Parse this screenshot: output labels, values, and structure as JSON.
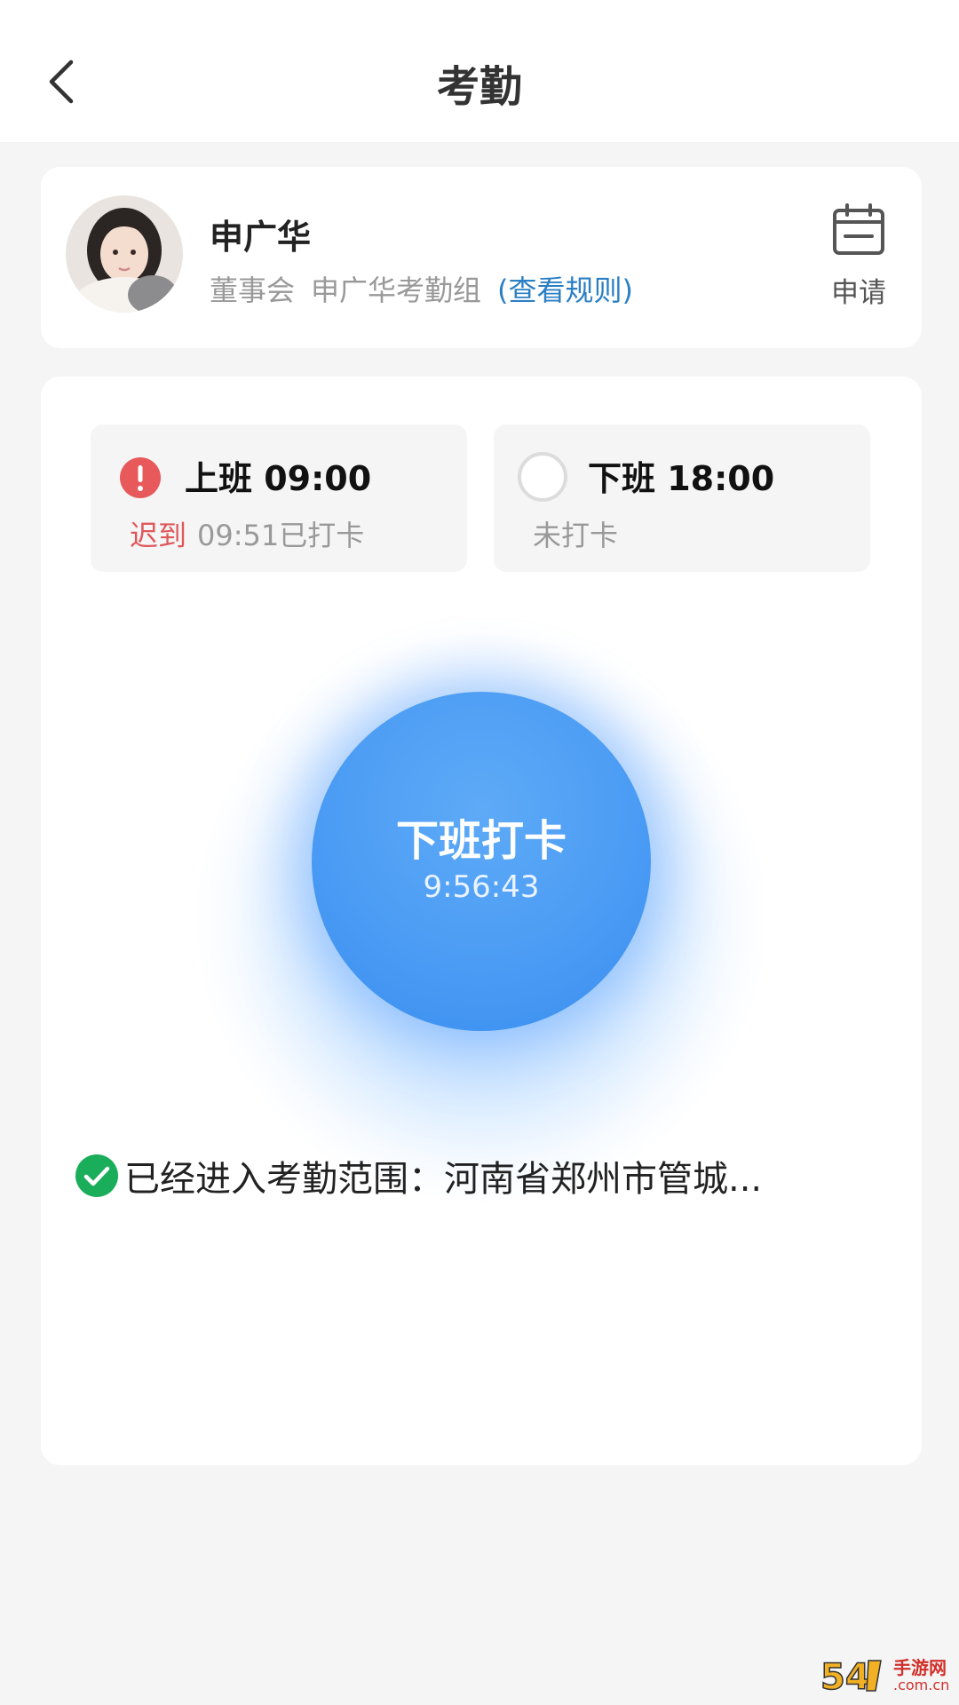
{
  "header": {
    "title": "考勤",
    "back_icon": "chevron-left-icon"
  },
  "profile": {
    "name": "申广华",
    "department": "董事会",
    "group": "申广华考勤组",
    "rule_link": "(查看规则)",
    "apply_label": "申请",
    "apply_icon": "calendar-icon"
  },
  "shifts": {
    "on_duty": {
      "title": "上班 09:00",
      "late_tag": "迟到",
      "status": "09:51已打卡",
      "icon": "alert-icon",
      "icon_color": "#e8595b"
    },
    "off_duty": {
      "title": "下班 18:00",
      "status": "未打卡",
      "icon": "empty-circle-icon"
    }
  },
  "punch": {
    "label": "下班打卡",
    "time": "9:56:43",
    "color": "#4b9cf4"
  },
  "location": {
    "text": "已经进入考勤范围：河南省郑州市管城...",
    "icon": "check-circle-icon",
    "icon_color": "#1aad5a"
  },
  "watermark": {
    "text": "手游网",
    "domain": ".com.cn",
    "logo_icon": "site-logo-icon"
  }
}
